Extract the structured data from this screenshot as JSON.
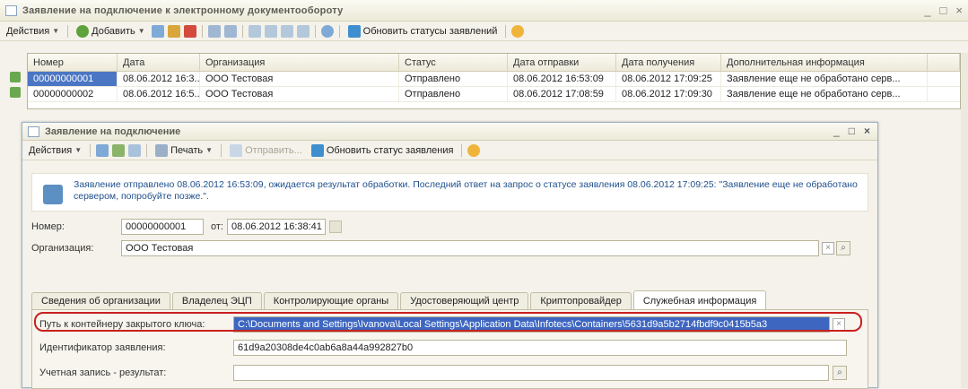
{
  "window": {
    "title": "Заявление на подключение к электронному документообороту",
    "controls": [
      "_",
      "□",
      "×"
    ]
  },
  "toolbar": {
    "actions_label": "Действия",
    "add_label": "Добавить",
    "refresh_statuses_label": "Обновить статусы заявлений"
  },
  "table": {
    "columns": [
      "Номер",
      "Дата",
      "Организация",
      "Статус",
      "Дата отправки",
      "Дата получения",
      "Дополнительная информация"
    ],
    "rows": [
      [
        "00000000001",
        "08.06.2012 16:3...",
        "ООО Тестовая",
        "Отправлено",
        "08.06.2012 16:53:09",
        "08.06.2012 17:09:25",
        "Заявление еще не обработано серв..."
      ],
      [
        "00000000002",
        "08.06.2012 16:5...",
        "ООО Тестовая",
        "Отправлено",
        "08.06.2012 17:08:59",
        "08.06.2012 17:09:30",
        "Заявление еще не обработано серв..."
      ]
    ]
  },
  "dialog": {
    "title": "Заявление на подключение",
    "controls": [
      "_",
      "□",
      "×"
    ],
    "toolbar": {
      "actions_label": "Действия",
      "print_label": "Печать",
      "send_label": "Отправить...",
      "refresh_status_label": "Обновить статус заявления"
    },
    "info_text": "Заявление отправлено 08.06.2012 16:53:09, ожидается результат обработки. Последний ответ на запрос о статусе заявления 08.06.2012 17:09:25: \"Заявление еще не обработано сервером, попробуйте позже.\".",
    "number_label": "Номер:",
    "number_value": "00000000001",
    "from_label": "от:",
    "date_value": "08.06.2012 16:38:41",
    "org_label": "Организация:",
    "org_value": "ООО Тестовая",
    "tabs": [
      "Сведения об организации",
      "Владелец ЭЦП",
      "Контролирующие органы",
      "Удостоверяющий центр",
      "Криптопровайдер",
      "Служебная информация"
    ],
    "active_tab": "Служебная информация",
    "container_label": "Путь к контейнеру закрытого ключа:",
    "container_value": "C:\\Documents and Settings\\Ivanova\\Local Settings\\Application Data\\Infotecs\\Containers\\5631d9a5b2714fbdf9c0415b5a3",
    "request_id_label": "Идентификатор заявления:",
    "request_id_value": "61d9a20308de4c0ab6a8a44a992827b0",
    "account_label": "Учетная запись - результат:",
    "account_value": ""
  },
  "colors": {
    "selection": "#4b76c4",
    "highlight_ring": "#c9201e",
    "info_text": "#1f4f8d"
  }
}
